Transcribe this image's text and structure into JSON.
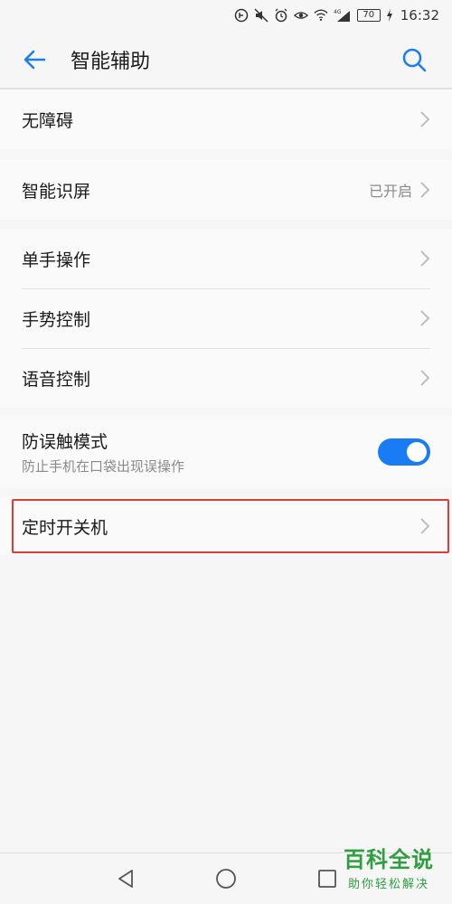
{
  "status_bar": {
    "battery": "70",
    "time": "16:32",
    "network_label": "4G"
  },
  "header": {
    "title": "智能辅助"
  },
  "groups": [
    {
      "items": [
        {
          "label": "无障碍"
        }
      ]
    },
    {
      "items": [
        {
          "label": "智能识屏",
          "value": "已开启"
        }
      ]
    },
    {
      "items": [
        {
          "label": "单手操作"
        },
        {
          "label": "手势控制"
        },
        {
          "label": "语音控制"
        }
      ]
    },
    {
      "items": [
        {
          "label": "防误触模式",
          "sublabel": "防止手机在口袋出现误操作",
          "toggle_on": true
        }
      ]
    },
    {
      "items": [
        {
          "label": "定时开关机"
        }
      ]
    }
  ],
  "watermark": {
    "title": "百科全说",
    "subtitle": "助你轻松解决"
  },
  "colors": {
    "accent": "#1a7cf4",
    "highlight": "#e53935",
    "watermark": "#2e9e3e"
  }
}
